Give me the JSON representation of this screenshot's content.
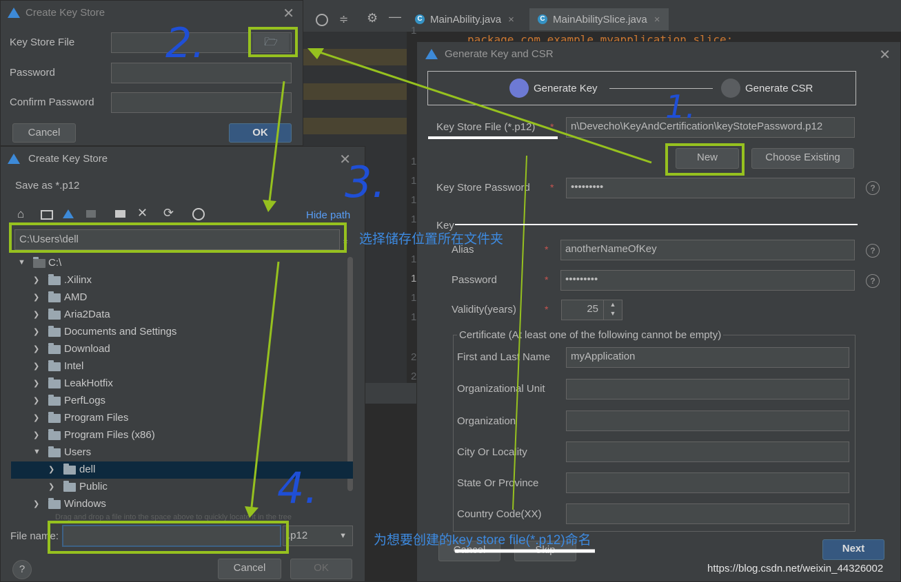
{
  "ide": {
    "tabs": [
      {
        "label": "MainAbility.java",
        "close": "×"
      },
      {
        "label": "MainAbilitySlice.java",
        "close": "×"
      }
    ],
    "code_line": "package com.example.myapplication.slice;",
    "line_numbers": [
      "1",
      "1",
      "1",
      "1",
      "1",
      "1",
      "1",
      "1",
      "1",
      "2",
      "2"
    ]
  },
  "create_key_store_top": {
    "title": "Create Key Store",
    "key_store_file_label": "Key Store File",
    "password_label": "Password",
    "confirm_password_label": "Confirm Password",
    "cancel_label": "Cancel",
    "ok_label": "OK"
  },
  "create_key_store_save": {
    "title": "Create Key Store",
    "subtitle": "Save as *.p12",
    "hide_path_label": "Hide path",
    "path_value": "C:\\Users\\dell",
    "tree": [
      {
        "name": "C:\\",
        "expanded": true
      },
      {
        "name": ".Xilinx"
      },
      {
        "name": "AMD"
      },
      {
        "name": "Aria2Data"
      },
      {
        "name": "Documents and Settings"
      },
      {
        "name": "Download"
      },
      {
        "name": "Intel"
      },
      {
        "name": "LeakHotfix"
      },
      {
        "name": "PerfLogs"
      },
      {
        "name": "Program Files"
      },
      {
        "name": "Program Files (x86)"
      },
      {
        "name": "Users",
        "expanded": true
      },
      {
        "name": "dell",
        "selected": true
      },
      {
        "name": "Public"
      },
      {
        "name": "Windows"
      }
    ],
    "drag_hint": "Drag and drop a file into the space above to quickly locate it in the tree",
    "file_name_label": "File name:",
    "file_name_value": "",
    "file_type_value": ".p12",
    "cancel_label": "Cancel",
    "ok_label": "OK",
    "help_label": "?"
  },
  "generate_key_csr": {
    "title": "Generate Key and CSR",
    "step1_label": "Generate Key",
    "step2_label": "Generate CSR",
    "key_store_file_label": "Key Store File (*.p12)",
    "key_store_file_value": "n\\Devecho\\KeyAndCertification\\keyStotePassword.p12",
    "new_label": "New",
    "choose_existing_label": "Choose Existing",
    "key_store_password_label": "Key Store Password",
    "key_store_password_value": "•••••••••",
    "key_section_label": "Key",
    "alias_label": "Alias",
    "alias_value": "anotherNameOfKey",
    "password_label": "Password",
    "password_value": "•••••••••",
    "validity_label": "Validity(years)",
    "validity_value": "25",
    "certificate_label": "Certificate (At least one of the following cannot be empty)",
    "first_last_name_label": "First and Last Name",
    "first_last_name_value": "myApplication",
    "org_unit_label": "Organizational Unit",
    "organization_label": "Organization",
    "city_label": "City Or Locality",
    "state_label": "State Or Province",
    "country_label": "Country Code(XX)",
    "cancel_label": "Cancel",
    "skip_label": "Skip",
    "next_label": "Next",
    "required_mark": "*",
    "help_mark": "?"
  },
  "annotations": {
    "n1": "1.",
    "n2": "2.",
    "n3": "3.",
    "n4": "4.",
    "choose_folder": "选择储存位置所在文件夹",
    "name_file": "为想要创建的key store file(*.p12)命名",
    "watermark": "https://blog.csdn.net/weixin_44326002"
  },
  "colors": {
    "highlight": "#96c11f",
    "accent": "#3d8ad8",
    "handwriting": "#1f4fd6",
    "required": "#c75450"
  }
}
